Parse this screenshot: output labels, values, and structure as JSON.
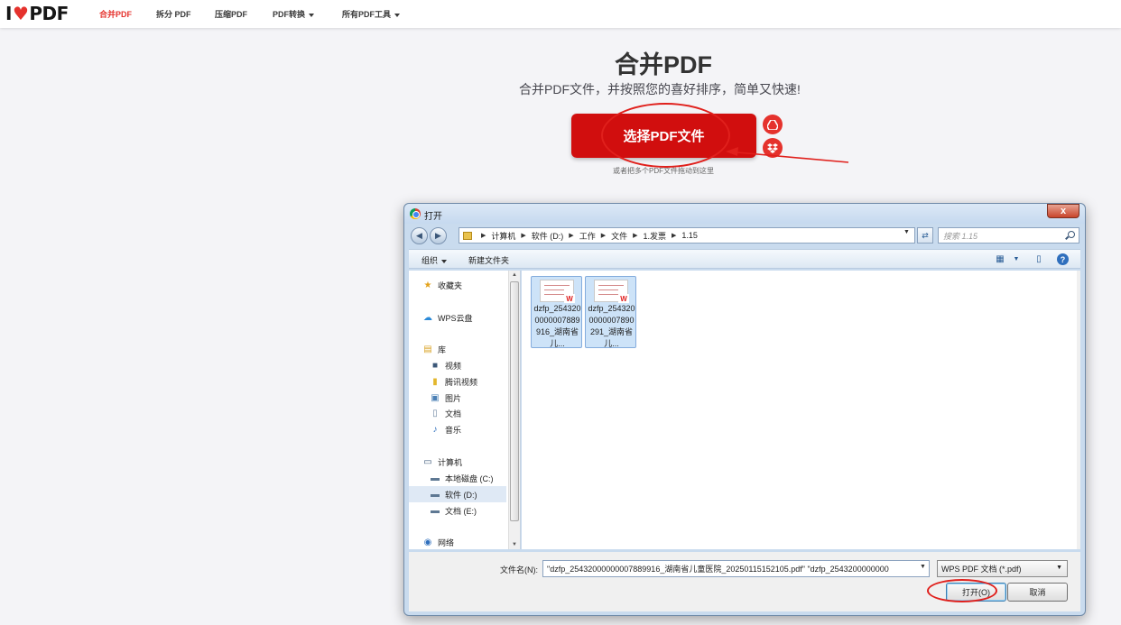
{
  "brand": {
    "logo_prefix": "I",
    "logo_heart": "♥",
    "logo_suffix": "PDF",
    "accent": "#e5322d"
  },
  "nav": {
    "items": [
      {
        "label": "合并PDF",
        "active": true
      },
      {
        "label": "拆分 PDF"
      },
      {
        "label": "压缩PDF"
      },
      {
        "label": "PDF转换",
        "dropdown": true
      },
      {
        "label": "所有PDF工具",
        "dropdown": true
      }
    ]
  },
  "hero": {
    "title": "合并PDF",
    "subtitle": "合并PDF文件，并按照您的喜好排序，简单又快速!",
    "select_button": "选择PDF文件",
    "drop_hint": "或者把多个PDF文件拖动到这里",
    "cloud_buttons": [
      "google-drive-icon",
      "dropbox-icon"
    ]
  },
  "dialog": {
    "title": "打开",
    "close_label": "x",
    "path": [
      "计算机",
      "软件 (D:)",
      "工作",
      "文件",
      "1.发票",
      "1.15"
    ],
    "search_placeholder": "搜索 1.15",
    "toolbar": {
      "organize": "组织",
      "new_folder": "新建文件夹"
    },
    "nav_pane": {
      "favorites": "收藏夹",
      "wps_cloud": "WPS云盘",
      "library": "库",
      "library_items": [
        "视频",
        "腾讯视频",
        "图片",
        "文档",
        "音乐"
      ],
      "computer": "计算机",
      "drives": [
        "本地磁盘 (C:)",
        "软件 (D:)",
        "文档 (E:)"
      ],
      "selected_drive": "软件 (D:)",
      "network": "网络"
    },
    "files": [
      {
        "name": "dzfp_2543200000007889916_湖南省儿..."
      },
      {
        "name": "dzfp_2543200000007890291_湖南省儿..."
      }
    ],
    "filename_label": "文件名(N):",
    "filename_value": "\"dzfp_25432000000007889916_湖南省儿童医院_20250115152105.pdf\" \"dzfp_2543200000000",
    "filetype": "WPS PDF 文档 (*.pdf)",
    "open_button": "打开(O)",
    "cancel_button": "取消"
  }
}
